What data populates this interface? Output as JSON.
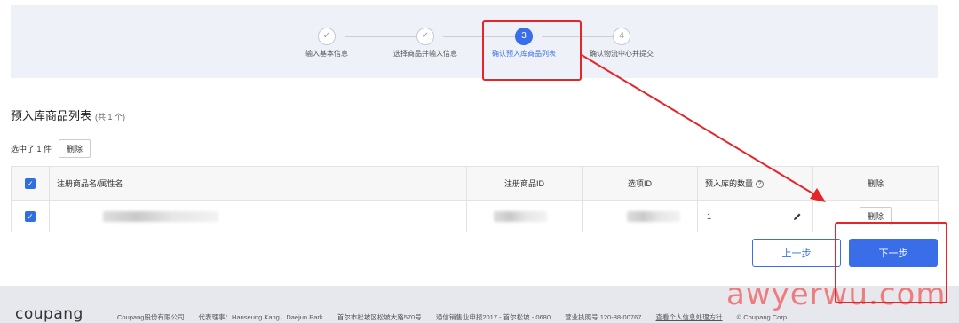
{
  "steps": [
    {
      "num": "✓",
      "label": "输入基本信息"
    },
    {
      "num": "✓",
      "label": "选择商品并输入信息"
    },
    {
      "num": "3",
      "label": "确认预入库商品列表"
    },
    {
      "num": "4",
      "label": "确认物流中心并提交"
    }
  ],
  "section": {
    "title": "预入库商品列表",
    "count": "(共 1 个)"
  },
  "selection": {
    "text": "选中了 1 件",
    "delete_label": "删除"
  },
  "table": {
    "headers": {
      "name": "注册商品名/属性名",
      "product_id": "注册商品ID",
      "option_id": "选项ID",
      "qty": "预入库的数量",
      "qty_help": "?",
      "delete": "删除"
    },
    "rows": [
      {
        "qty": "1",
        "delete_label": "删除"
      }
    ]
  },
  "buttons": {
    "prev": "上一步",
    "next": "下一步"
  },
  "footer": {
    "logo": "coupang",
    "company": "Coupang股份有限公司",
    "ceo": "代表理事：Hanseung Kang，Daejun Park",
    "address": "首尔市松坡区松坡大路570号",
    "telecom": "通信销售业申报2017 - 首尔松坡 - 0680",
    "license": "营业执照号 120-88-00767",
    "privacy": "查看个人信息处理方针",
    "copyright": "© Coupang Corp."
  },
  "watermark": "awyerwu.com",
  "colors": {
    "accent": "#3a6ee8",
    "annotation": "#e5252a"
  }
}
